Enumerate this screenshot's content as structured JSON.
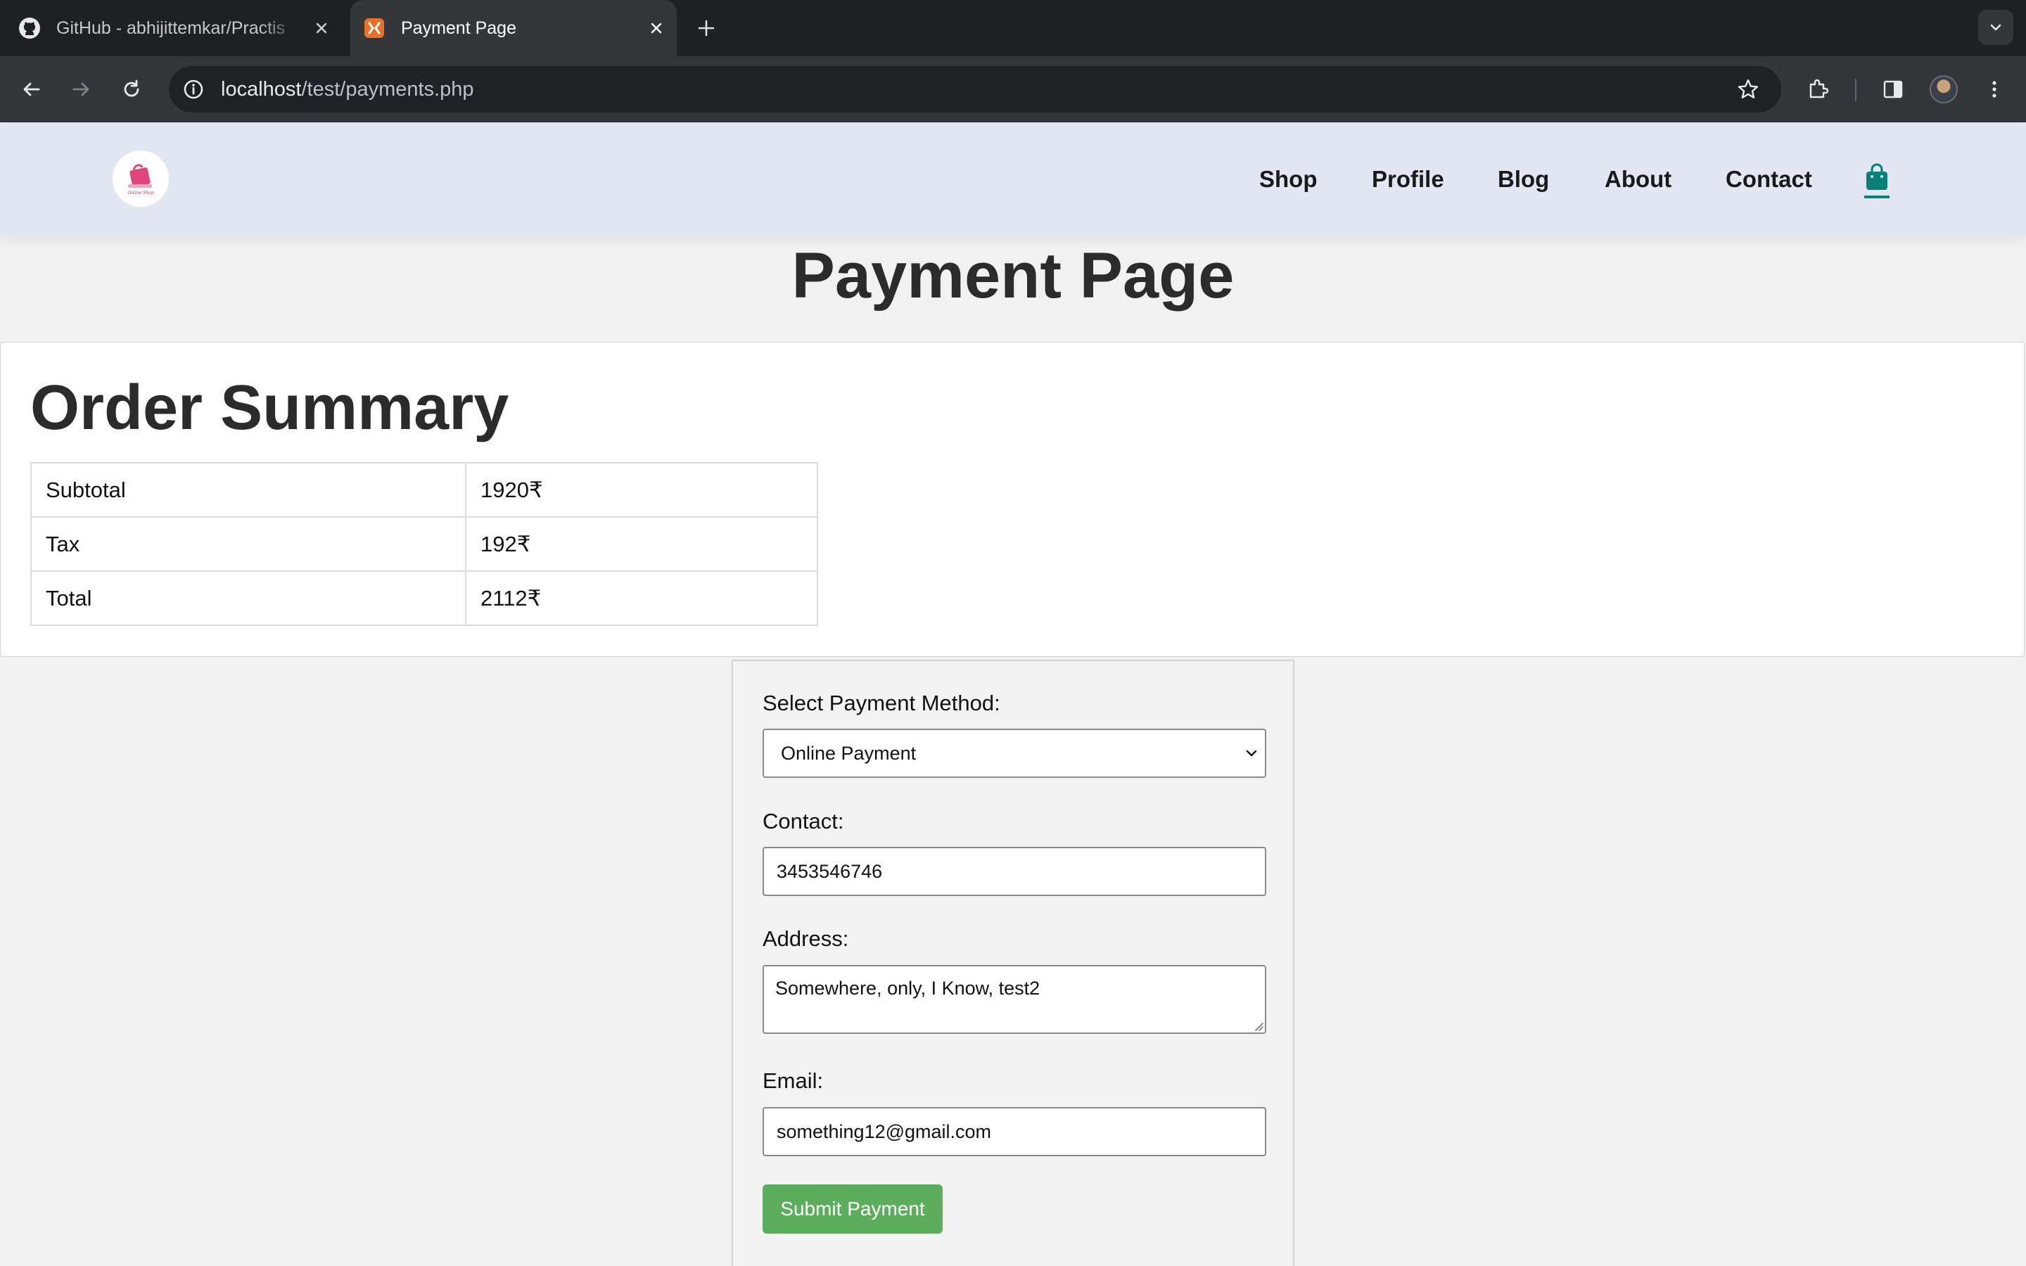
{
  "browser": {
    "tabs": [
      {
        "title": "GitHub - abhijittemkar/Practis",
        "icon": "github-icon",
        "active": false
      },
      {
        "title": "Payment Page",
        "icon": "xampp-icon",
        "active": true
      }
    ],
    "url_host": "localhost",
    "url_path": "/test/payments.php"
  },
  "site": {
    "logo_text": "Online Shop",
    "nav": {
      "shop": "Shop",
      "profile": "Profile",
      "blog": "Blog",
      "about": "About",
      "contact": "Contact"
    },
    "cart_icon": "shopping-bag-icon",
    "accent_color": "#088178"
  },
  "page": {
    "title": "Payment Page"
  },
  "summary": {
    "title": "Order Summary",
    "rows": [
      {
        "label": "Subtotal",
        "value": "1920₹"
      },
      {
        "label": "Tax",
        "value": "192₹"
      },
      {
        "label": "Total",
        "value": "2112₹"
      }
    ]
  },
  "form": {
    "method_label": "Select Payment Method:",
    "method_value": "Online Payment",
    "contact_label": "Contact:",
    "contact_value": "3453546746",
    "address_label": "Address:",
    "address_value": "Somewhere, only, I Know, test2",
    "email_label": "Email:",
    "email_value": "something12@gmail.com",
    "submit_label": "Submit Payment",
    "submit_color": "#5cae5d"
  }
}
